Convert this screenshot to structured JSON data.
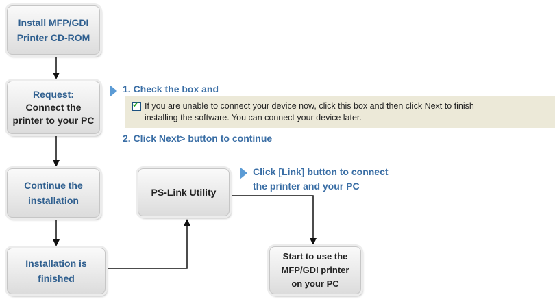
{
  "boxes": {
    "install_cd": "Install MFP/GDI\nPrinter CD-ROM",
    "request_title": "Request:",
    "request_body": "Connect the\nprinter to your PC",
    "continue_install": "Continue the\ninstallation",
    "install_finished": "Installation is\nfinished",
    "ps_link": "PS-Link Utility",
    "start_use": "Start to use the\nMFP/GDI printer\non your PC"
  },
  "notes": {
    "step1": "1. Check the box and",
    "checkbox_text": "If you are unable to connect your device now, click this box and then click Next to finish\ninstalling the software. You can connect your device later.",
    "checkbox_checked": true,
    "step2": "2. Click Next> button to continue",
    "link_note": "Click [Link] button to connect\nthe printer and your PC"
  },
  "colors": {
    "label_blue": "#3a6ea5",
    "arrow_blue": "#5b9bd5",
    "panel_bg": "#ece9d8",
    "check_green": "#21a121"
  }
}
